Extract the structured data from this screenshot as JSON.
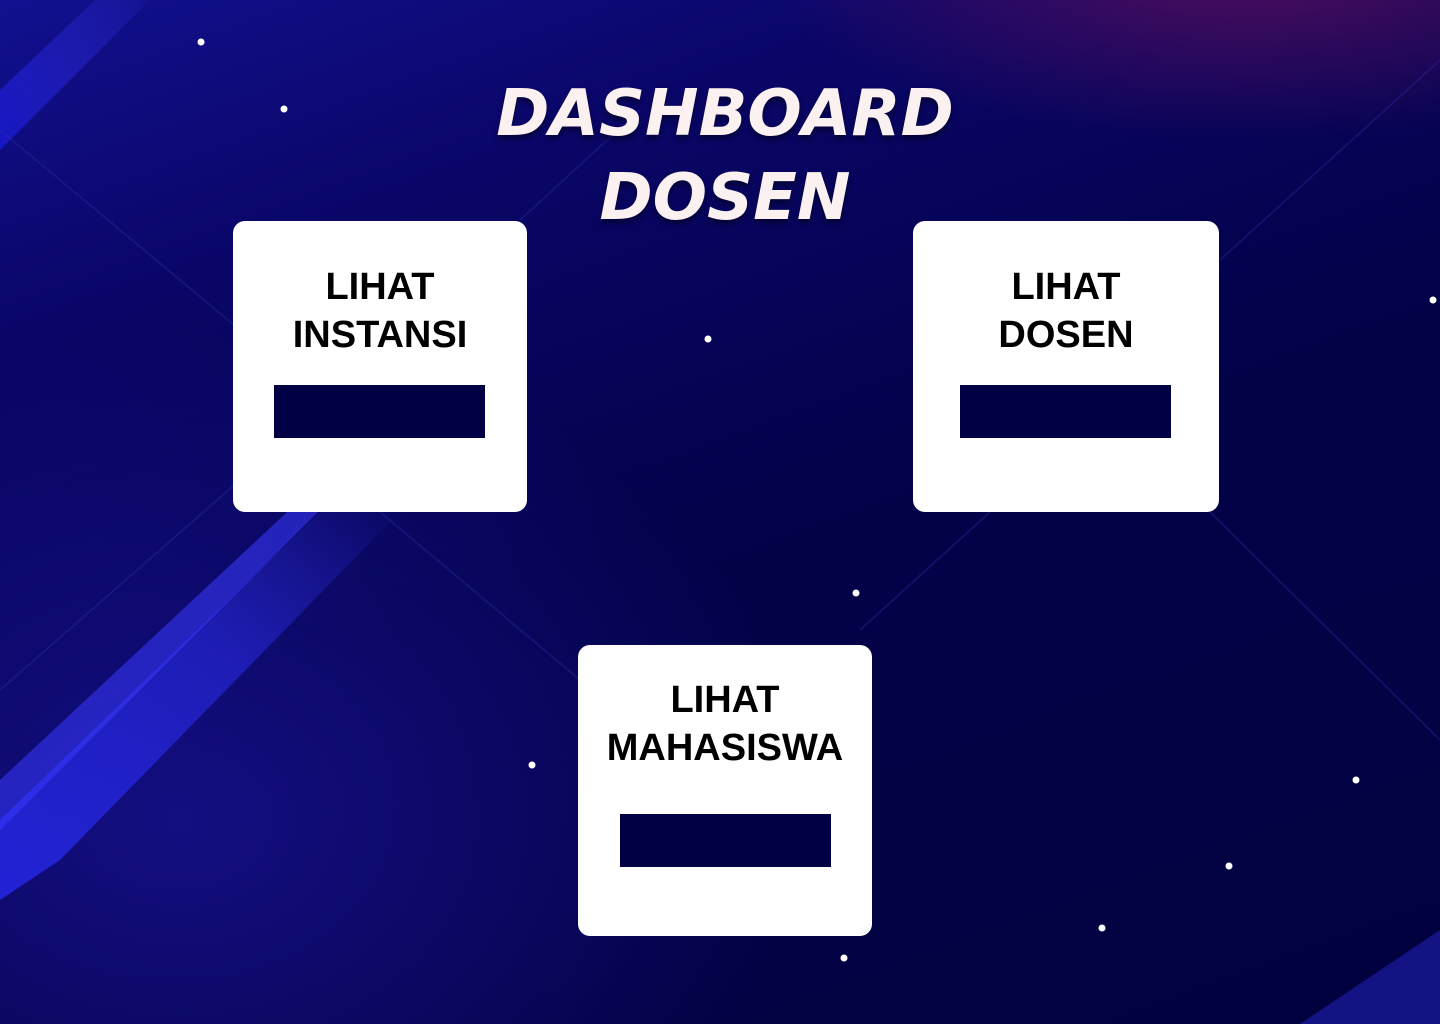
{
  "title": {
    "line1": "DASHBOARD",
    "line2": "DOSEN"
  },
  "cards": [
    {
      "line1": "LIHAT",
      "line2": "INSTANSI",
      "button_label": ""
    },
    {
      "line1": "LIHAT",
      "line2": "DOSEN",
      "button_label": ""
    },
    {
      "line1": "LIHAT",
      "line2": "MAHASISWA",
      "button_label": ""
    }
  ],
  "colors": {
    "background": "#03024a",
    "card": "#ffffff",
    "button": "#020045",
    "title_text": "#fbf1f0"
  }
}
